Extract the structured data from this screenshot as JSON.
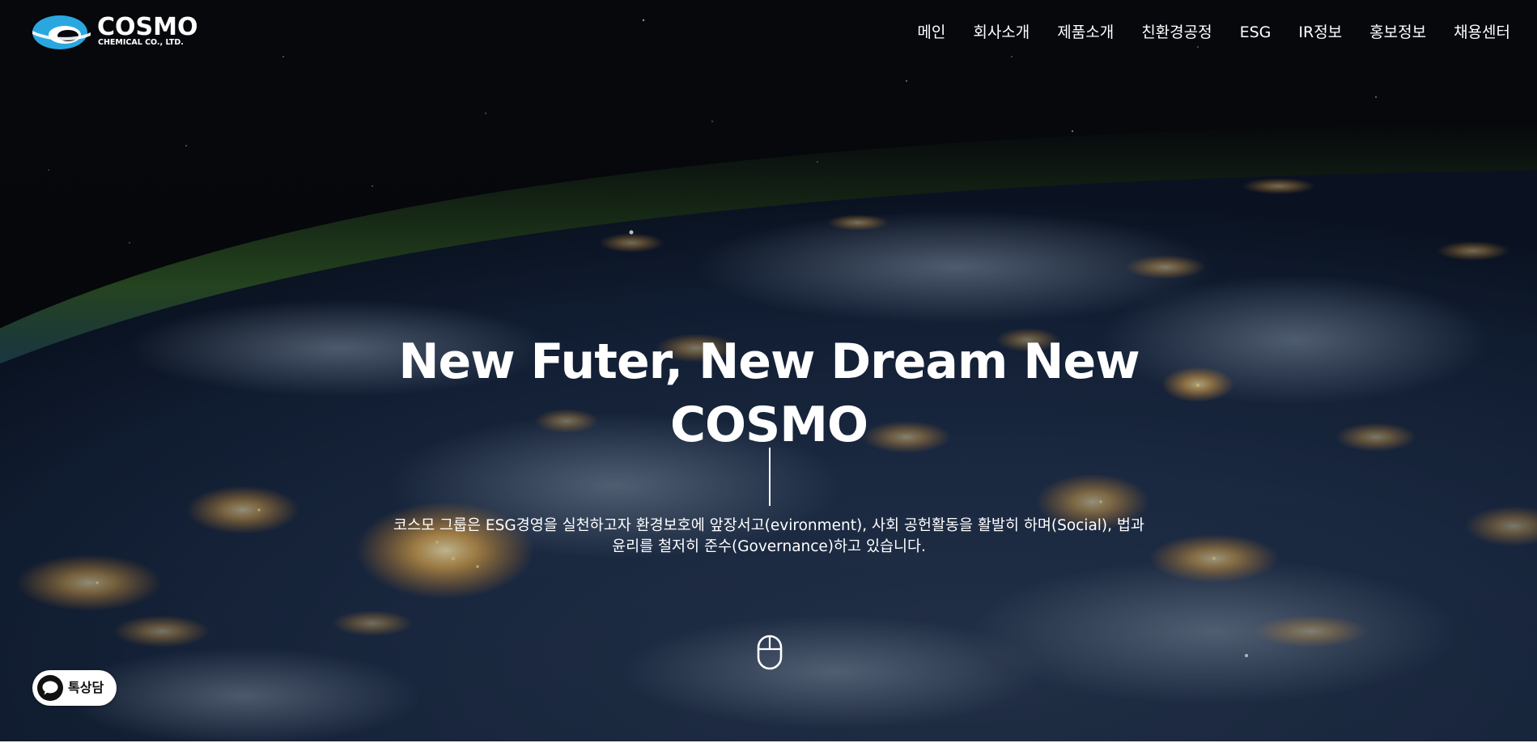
{
  "brand": {
    "name": "COSMO",
    "subtitle": "CHEMICAL CO., LTD.",
    "logo_color": "#2aa7df"
  },
  "nav": {
    "items": [
      {
        "label": "메인"
      },
      {
        "label": "회사소개"
      },
      {
        "label": "제품소개"
      },
      {
        "label": "친환경공정"
      },
      {
        "label": "ESG"
      },
      {
        "label": "IR정보"
      },
      {
        "label": "홍보정보"
      },
      {
        "label": "채용센터"
      }
    ]
  },
  "hero": {
    "title_line1": "New Futer, New Dream New",
    "title_line2": "COSMO",
    "description_line1": "코스모 그룹은 ESG경영을 실천하고자 환경보호에 앞장서고(evironment), 사회 공헌활동을 활발히 하며(Social), 법과",
    "description_line2": "윤리를 철저히 준수(Governance)하고 있습니다.",
    "scroll_icon": "mouse-icon"
  },
  "chat": {
    "label": "톡상담",
    "icon": "chat-bubble-icon",
    "accent": "#111111"
  },
  "colors": {
    "space": "#06080d",
    "ocean": "#1b2a44",
    "city_lights": "#ffc15a",
    "atmosphere": "#4a8a3a"
  }
}
